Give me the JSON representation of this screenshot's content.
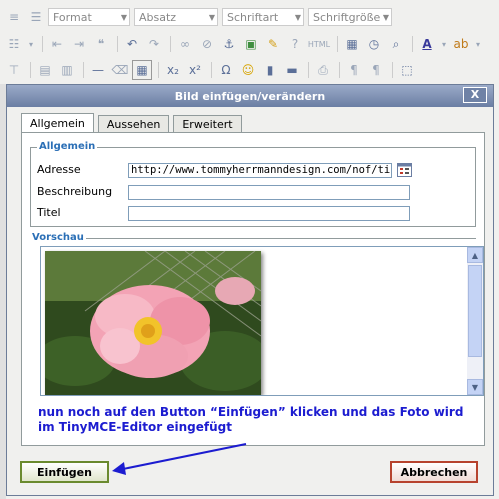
{
  "toolbar": {
    "format_select": "Format",
    "paragraph_select": "Absatz",
    "font_select": "Schriftart",
    "size_select": "Schriftgröße",
    "html_label": "HTML"
  },
  "dialog": {
    "title": "Bild einfügen/verändern",
    "close_label": "X",
    "tabs": [
      "Allgemein",
      "Aussehen",
      "Erweitert"
    ],
    "general": {
      "legend": "Allgemein",
      "address_label": "Adresse",
      "address_value": "http://www.tommyherrmanndesign.com/nof/tir",
      "description_label": "Beschreibung",
      "description_value": "",
      "title_label": "Titel",
      "title_value": ""
    },
    "preview": {
      "legend": "Vorschau"
    },
    "insert_button": "Einfügen",
    "cancel_button": "Abbrechen"
  },
  "annotation": {
    "line1": "nun noch auf den Button “Einfügen” klicken und das Foto wird",
    "line2": "im TinyMCE-Editor eingefügt"
  },
  "colors": {
    "annotation_text": "#1c1cd0",
    "arrow": "#1c1cd0",
    "legend_text": "#2b6fb6",
    "insert_border": "#6a8a2e",
    "cancel_border": "#b7432e",
    "titlebar": "#7b8db0"
  }
}
